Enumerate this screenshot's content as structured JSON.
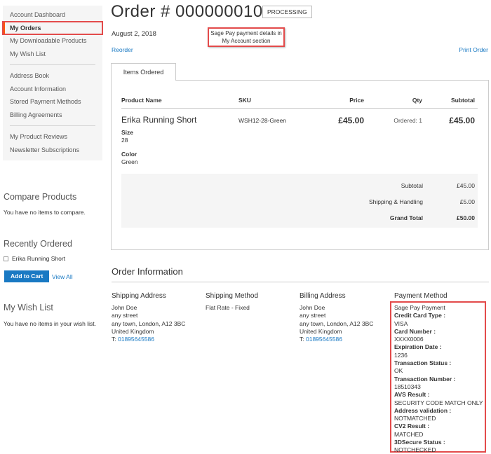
{
  "sidebar": {
    "items_group1": [
      "Account Dashboard",
      "My Orders",
      "My Downloadable Products",
      "My Wish List"
    ],
    "items_group2": [
      "Address Book",
      "Account Information",
      "Stored Payment Methods",
      "Billing Agreements"
    ],
    "items_group3": [
      "My Product Reviews",
      "Newsletter Subscriptions"
    ],
    "current": "My Orders"
  },
  "compare": {
    "title": "Compare Products",
    "empty": "You have no items to compare."
  },
  "recently_ordered": {
    "title": "Recently Ordered",
    "item": "Erika Running Short",
    "add_to_cart": "Add to Cart",
    "view_all": "View All"
  },
  "wishlist": {
    "title": "My Wish List",
    "empty": "You have no items in your wish list."
  },
  "order": {
    "title": "Order # 000000010",
    "status": "PROCESSING",
    "date": "August 2, 2018",
    "reorder": "Reorder",
    "print": "Print Order",
    "annotation_line1": "Sage Pay payment details in",
    "annotation_line2": "My Account section"
  },
  "tab": {
    "label": "Items Ordered"
  },
  "table": {
    "headers": {
      "name": "Product Name",
      "sku": "SKU",
      "price": "Price",
      "qty": "Qty",
      "subtotal": "Subtotal"
    },
    "row": {
      "name": "Erika Running Short",
      "sku": "WSH12-28-Green",
      "price": "£45.00",
      "qty": "Ordered: 1",
      "subtotal": "£45.00",
      "opt1_label": "Size",
      "opt1_value": "28",
      "opt2_label": "Color",
      "opt2_value": "Green"
    }
  },
  "totals": {
    "subtotal_label": "Subtotal",
    "subtotal": "£45.00",
    "shipping_label": "Shipping & Handling",
    "shipping": "£5.00",
    "grand_label": "Grand Total",
    "grand": "£50.00"
  },
  "info": {
    "title": "Order Information",
    "shipping_address": {
      "title": "Shipping Address",
      "lines": [
        "John Doe",
        "any street",
        "any town, London, A12 3BC",
        "United Kingdom"
      ],
      "phone_prefix": "T:",
      "phone": "01895645586"
    },
    "shipping_method": {
      "title": "Shipping Method",
      "value": "Flat Rate - Fixed"
    },
    "billing_address": {
      "title": "Billing Address",
      "lines": [
        "John Doe",
        "any street",
        "any town, London, A12 3BC",
        "United Kingdom"
      ],
      "phone_prefix": "T:",
      "phone": "01895645586"
    },
    "payment": {
      "title": "Payment Method",
      "name": "Sage Pay Payment",
      "fields": [
        {
          "label": "Credit Card Type :",
          "value": "VISA"
        },
        {
          "label": "Card Number :",
          "value": "XXXX0006"
        },
        {
          "label": "Expiration Date :",
          "value": "1236"
        },
        {
          "label": "Transaction Status :",
          "value": "OK"
        },
        {
          "label": "Transaction Number :",
          "value": "18510343"
        },
        {
          "label": "AVS Result :",
          "value": "SECURITY CODE MATCH ONLY"
        },
        {
          "label": "Address validation :",
          "value": "NOTMATCHED"
        },
        {
          "label": "CV2 Result :",
          "value": "MATCHED"
        },
        {
          "label": "3DSecure Status :",
          "value": "NOTCHECKED"
        }
      ]
    }
  },
  "colors": {
    "link": "#1979c3",
    "highlight": "#e34b4b",
    "accent": "#ff5501"
  }
}
